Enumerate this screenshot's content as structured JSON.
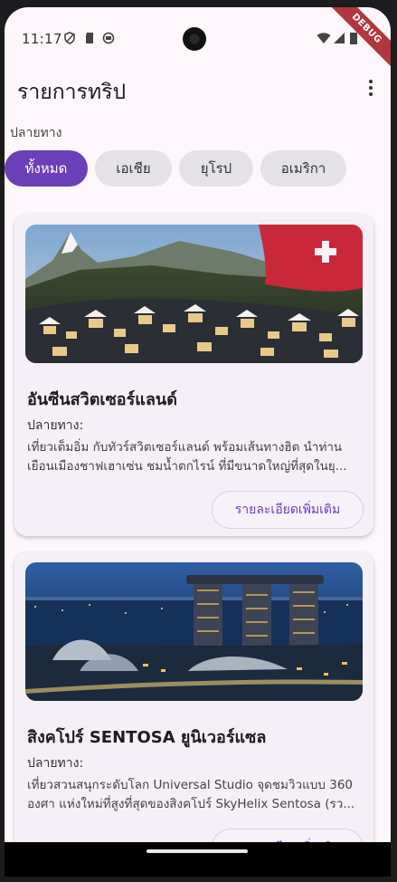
{
  "status": {
    "time": "11:17",
    "debug": "DEBUG"
  },
  "appbar": {
    "title": "รายการทริป"
  },
  "filter": {
    "label": "ปลายทาง",
    "chips": [
      "ทั้งหมด",
      "เอเชีย",
      "ยุโรป",
      "อเมริกา"
    ],
    "selected": "ทั้งหมด"
  },
  "trips": [
    {
      "title": "อันซีนสวิตเซอร์แลนด์",
      "destination_label": "ปลายทาง:",
      "description": "เที่ยวเต็มอิ่ม กับทัวร์สวิตเซอร์แลนด์ พร้อมเส้นทางฮิต นำท่านเยือนเมืองชาฟเฮาเซ่น ชมน้ำตกไรน์ ที่มีขนาดใหญ่ที่สุดในยุ...",
      "button": "รายละเอียดเพิ่มเติม"
    },
    {
      "title": "สิงคโปร์ SENTOSA ยูนิเวอร์แซล",
      "destination_label": "ปลายทาง:",
      "description": "เที่ยวสวนสนุกระดับโลก Universal Studio จุดชมวิวแบบ 360 องศา แห่งใหม่ที่สูงที่สุดของสิงคโปร์ SkyHelix Sentosa (รว...",
      "button": "รายละเอียดเพิ่มเติม"
    }
  ],
  "colors": {
    "accent": "#6a3fb8",
    "background": "#fdf6fb",
    "card": "#f5eff7"
  }
}
